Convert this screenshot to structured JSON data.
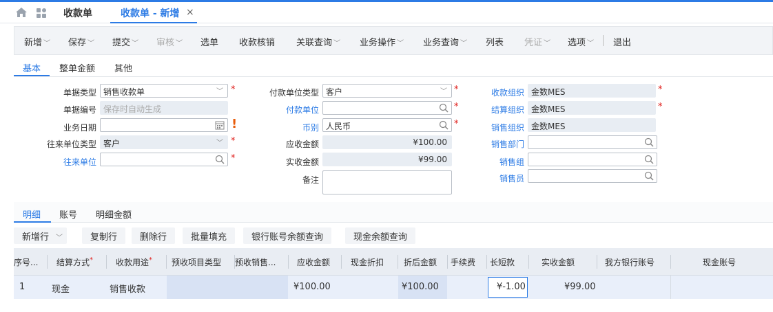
{
  "tabs": {
    "home_icon": "home-icon",
    "apps_icon": "apps-grid-icon",
    "t1": "收款单",
    "t2": "收款单 - 新增",
    "close": "×"
  },
  "toolbar": {
    "new": "新增",
    "save": "保存",
    "submit": "提交",
    "audit": "审核",
    "select": "选单",
    "verify": "收款核销",
    "related": "关联查询",
    "bizops": "业务操作",
    "bizquery": "业务查询",
    "list": "列表",
    "voucher": "凭证",
    "options": "选项",
    "exit": "退出"
  },
  "subtabs": {
    "basic": "基本",
    "amount": "整单金额",
    "other": "其他"
  },
  "form": {
    "bill_type_label": "单据类型",
    "bill_type_value": "销售收款单",
    "bill_no_label": "单据编号",
    "bill_no_placeholder": "保存时自动生成",
    "biz_date_label": "业务日期",
    "partner_type_label": "往来单位类型",
    "partner_type_value": "客户",
    "partner_label": "往来单位",
    "payer_type_label": "付款单位类型",
    "payer_type_value": "客户",
    "payer_label": "付款单位",
    "currency_label": "币别",
    "currency_value": "人民币",
    "receivable_label": "应收金额",
    "receivable_value": "¥100.00",
    "received_label": "实收金额",
    "received_value": "¥99.00",
    "remark_label": "备注",
    "recv_org_label": "收款组织",
    "recv_org_value": "金数MES",
    "settle_org_label": "结算组织",
    "settle_org_value": "金数MES",
    "sales_org_label": "销售组织",
    "sales_org_value": "金数MES",
    "sales_dept_label": "销售部门",
    "sales_group_label": "销售组",
    "salesman_label": "销售员",
    "required_mark": "*",
    "warn_mark": "!"
  },
  "detail_tabs": {
    "detail": "明细",
    "account": "账号",
    "detail_amount": "明细金额"
  },
  "detail_toolbar": {
    "add_row": "新增行",
    "copy_row": "复制行",
    "delete_row": "删除行",
    "batch_fill": "批量填充",
    "bank_balance": "银行账号余额查询",
    "cash_balance": "现金余额查询"
  },
  "table": {
    "headers": [
      "序号...",
      "结算方式",
      "收款用途",
      "预收项目类型",
      "预收销售...",
      "应收金额",
      "现金折扣",
      "折后金额",
      "手续费",
      "长短款",
      "实收金额",
      "我方银行账号",
      "现金账号"
    ],
    "required_star": "*",
    "row": {
      "seq": "1",
      "settle_method": "现金",
      "purpose": "销售收款",
      "receivable": "¥100.00",
      "discounted": "¥100.00",
      "over_short": "¥-1.00",
      "received": "¥99.00"
    }
  },
  "colors": {
    "accent": "#2c7be5",
    "required": "#e0201d",
    "warning": "#e85d0c"
  }
}
